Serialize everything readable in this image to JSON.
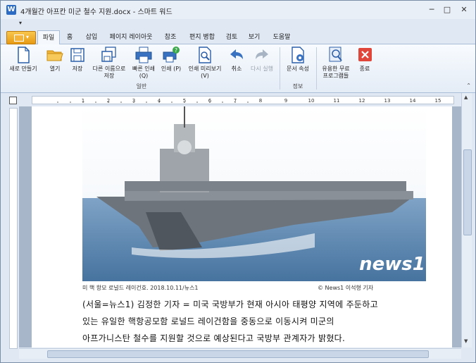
{
  "window": {
    "title": "4개월간 아프칸 미군 철수 지원.docx - 스마트 워드",
    "minimize": "─",
    "maximize": "□",
    "close": "✕"
  },
  "tabs": [
    {
      "label": "파일",
      "active": true
    },
    {
      "label": "홈"
    },
    {
      "label": "삽입"
    },
    {
      "label": "페이지 레이아웃"
    },
    {
      "label": "참조"
    },
    {
      "label": "편지 병합"
    },
    {
      "label": "검토"
    },
    {
      "label": "보기"
    },
    {
      "label": "도움말"
    }
  ],
  "ribbon": {
    "new": "새로 만들기",
    "open": "열기",
    "save": "저장",
    "save_as": "다른 이름으로 저장",
    "quick_print": "빠른 인쇄 (Q)",
    "print": "인쇄 (P)",
    "print_preview": "인쇄 미리보기 (V)",
    "undo": "취소",
    "redo": "다시 실행",
    "doc_props": "문서 속성",
    "free_programs": "유용한 무료 프로그램들",
    "exit": "종료",
    "group_general": "일반",
    "group_info": "정보"
  },
  "ruler_numbers": [
    "1",
    "2",
    "3",
    "4",
    "5",
    "6",
    "7",
    "8",
    "9",
    "10",
    "11",
    "12",
    "13",
    "14",
    "15"
  ],
  "document": {
    "photo_watermark": "news1",
    "caption": {
      "left": "미 핵 항모 로널드 레이건호. 2018.10.11/뉴스1",
      "right": "© News1 이석형 기자"
    },
    "paragraph_lines": [
      "(서울=뉴스1) 김정한 기자 = 미국 국방부가 현재 아시아 태평양 지역에 주둔하고",
      "있는 유일한 핵항공모함 로널드 레이건함을 중동으로 이동시켜 미군의",
      "아프가니스탄 철수를 지원할 것으로 예상된다고 국방부 관계자가 밝혔다."
    ]
  }
}
